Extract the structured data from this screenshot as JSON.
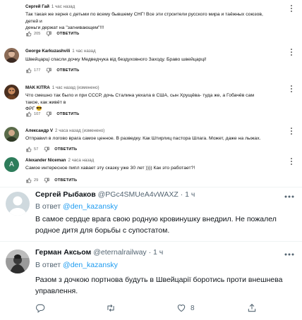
{
  "youtube": {
    "reply_label": "ОТВЕТИТЬ",
    "comments": [
      {
        "author": "Сергей Гай",
        "time": "1 час назад",
        "lines": [
          "Так такая же херня с детьми по всему бывшему СНГ! Все эти строители русского мира и таёжных союзов, детей и",
          "деньги держат на \"загнивающем\"!!!"
        ],
        "likes": "205"
      },
      {
        "author": "George Karkuzashvili",
        "time": "1 час назад",
        "lines": [
          "Швейцарці спасли дочку Медведчука від бездуховного Заходу. Браво швейцарці!"
        ],
        "likes": "177"
      },
      {
        "author": "MAK KITRA",
        "time": "1 час назад (изменено)",
        "lines": [
          "Что смешно так было и при СССР, дочь Сталина уехала в США, сын Хрущёва- туда же, а Гобачёв сам такое, как живёт в",
          "ФРГ 😎"
        ],
        "likes": "107"
      },
      {
        "author": "Александр V",
        "time": "2 часа назад (изменено)",
        "lines": [
          "Отправил в логово врага самое ценное. В разведку. Как Штирлиц пастора Шлага. Может, даже на лыжах."
        ],
        "likes": "57"
      },
      {
        "author": "Alexander Niceman",
        "time": "2 часа назад",
        "avatar_letter": "A",
        "lines": [
          "Самое интересное пипл хавает эту сказку уже 30 лет )))) Как это работает?!"
        ],
        "likes": "29"
      }
    ],
    "colors": {
      "avatar_green": "#2e7d5b",
      "text_secondary": "#606060"
    }
  },
  "twitter": {
    "reply_prefix": "В ответ",
    "tweets": [
      {
        "name": "Сергей Рыбаков",
        "handle": "@PGc4SMUeA4vWAXZ",
        "dot": "·",
        "time": "1 ч",
        "reply_to": "@den_kazansky",
        "lines": [
          "В самое сердце врага свою родную кровинушку внедрил. Не пожалел",
          "родное дитя для борьбы с супостатом."
        ]
      },
      {
        "name": "Герман Аксьом",
        "handle": "@eternalrailway",
        "dot": "·",
        "time": "1 ч",
        "reply_to": "@den_kazansky",
        "lines": [
          "Разом з дочкою портнова будуть в Швейцарії боротись проти внешнева",
          "управлення."
        ],
        "likes": "8"
      }
    ],
    "colors": {
      "link": "#1d9bf0",
      "secondary": "#536471",
      "separator": "#eff3f4"
    }
  }
}
